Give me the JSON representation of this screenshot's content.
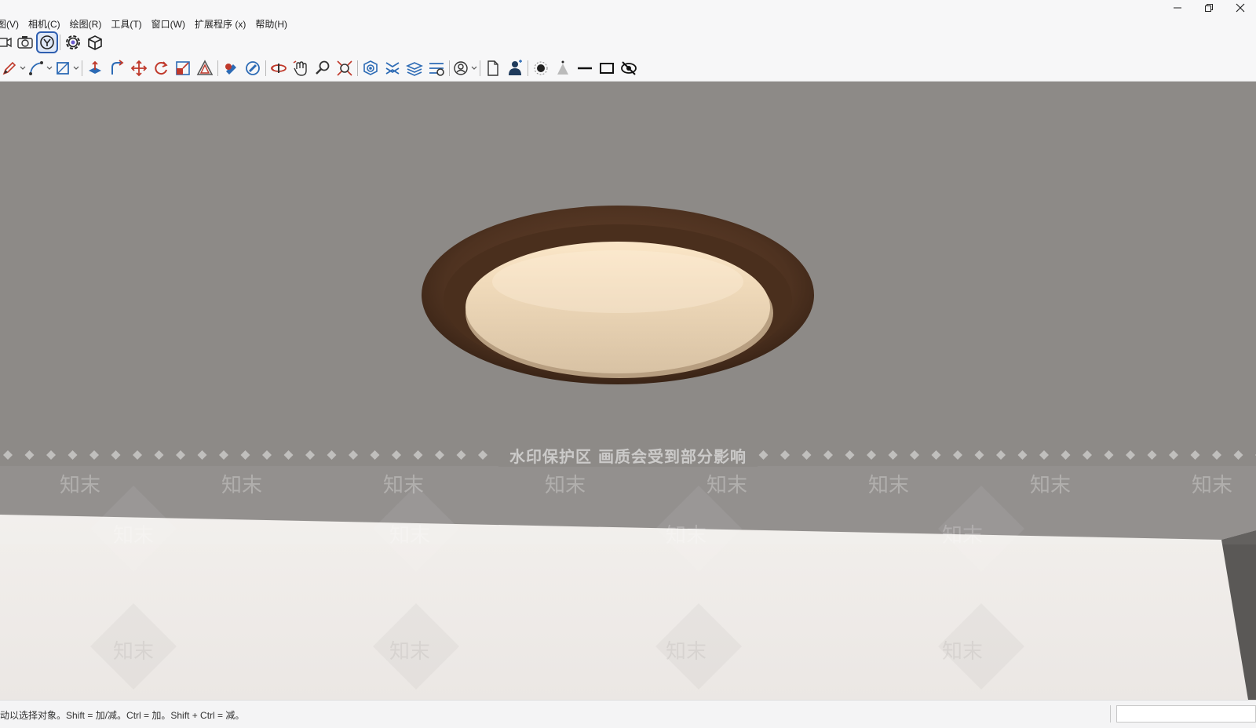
{
  "menu": {
    "items": [
      "图(V)",
      "相机(C)",
      "绘图(R)",
      "工具(T)",
      "窗口(W)",
      "扩展程序 (x)",
      "帮助(H)"
    ]
  },
  "window_controls": [
    "minimize-icon",
    "restore-icon",
    "close-icon"
  ],
  "toolbar_top": {
    "tools": [
      "camera-views-icon",
      "camera-icon",
      "walkthrough-icon",
      "settings-gear-icon",
      "box-3d-icon"
    ],
    "active_tool": "walkthrough-icon"
  },
  "toolbar_main": {
    "tools": [
      "pencil-icon",
      "arc-icon",
      "rectangle-icon",
      "push-pull-icon",
      "follow-me-icon",
      "move-icon",
      "rotate-icon",
      "scale-icon",
      "offset-icon",
      "paint-icon",
      "eraser-icon",
      "orbit-icon",
      "pan-icon",
      "zoom-icon",
      "zoom-extents-icon",
      "section-plane-icon",
      "section-display-icon",
      "layers-icon",
      "styles-icon",
      "user-icon",
      "document-icon",
      "person-icon",
      "shadow-icon",
      "fog-icon",
      "line-icon",
      "frame-icon",
      "hide-icon"
    ]
  },
  "viewport": {
    "watermark_text": "水印保护区   画质会受到部分影响",
    "watermark_logo": "知末",
    "colors": {
      "background": "#8d8a87",
      "ceiling": "#efece9",
      "wood": "#5a3a24",
      "diffuser": "#e9d3b4"
    }
  },
  "status": {
    "hint": "动以选择对象。Shift = 加/减。Ctrl = 加。Shift + Ctrl = 减。",
    "measurements_value": ""
  }
}
